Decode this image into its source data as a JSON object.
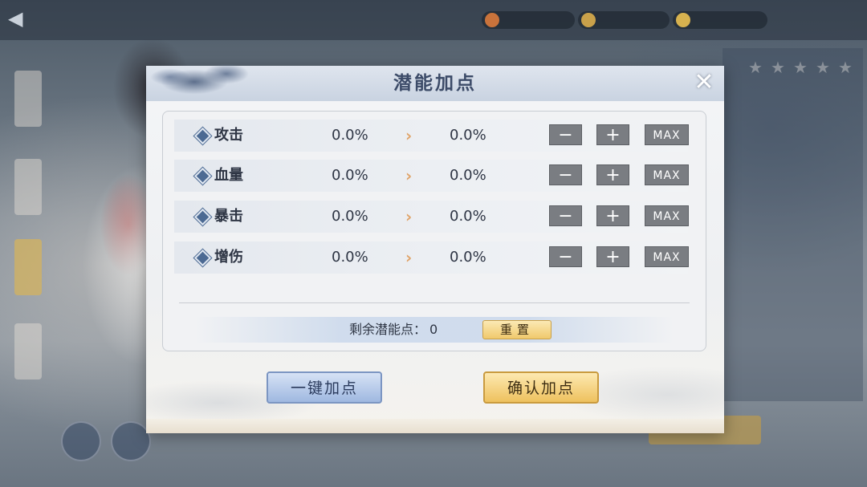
{
  "background": {
    "title": "",
    "back_icon": "back-arrow-icon"
  },
  "modal": {
    "title": "潜能加点",
    "close_icon": "close-icon",
    "stats": [
      {
        "name": "攻击",
        "current": "0.0%",
        "next": "0.0%"
      },
      {
        "name": "血量",
        "current": "0.0%",
        "next": "0.0%"
      },
      {
        "name": "暴击",
        "current": "0.0%",
        "next": "0.0%"
      },
      {
        "name": "增伤",
        "current": "0.0%",
        "next": "0.0%"
      }
    ],
    "minus_label": "−",
    "plus_label": "+",
    "max_label": "MAX",
    "arrow_glyph": "›",
    "remaining_label": "剩余潜能点：",
    "remaining_value": "0",
    "reset_label": "重置",
    "auto_button": "一键加点",
    "confirm_button": "确认加点"
  },
  "colors": {
    "accent_gold": "#f0c96c",
    "accent_blue": "#9fb8e0",
    "title_text": "#3c4b68",
    "arrow": "#e0a46a"
  }
}
